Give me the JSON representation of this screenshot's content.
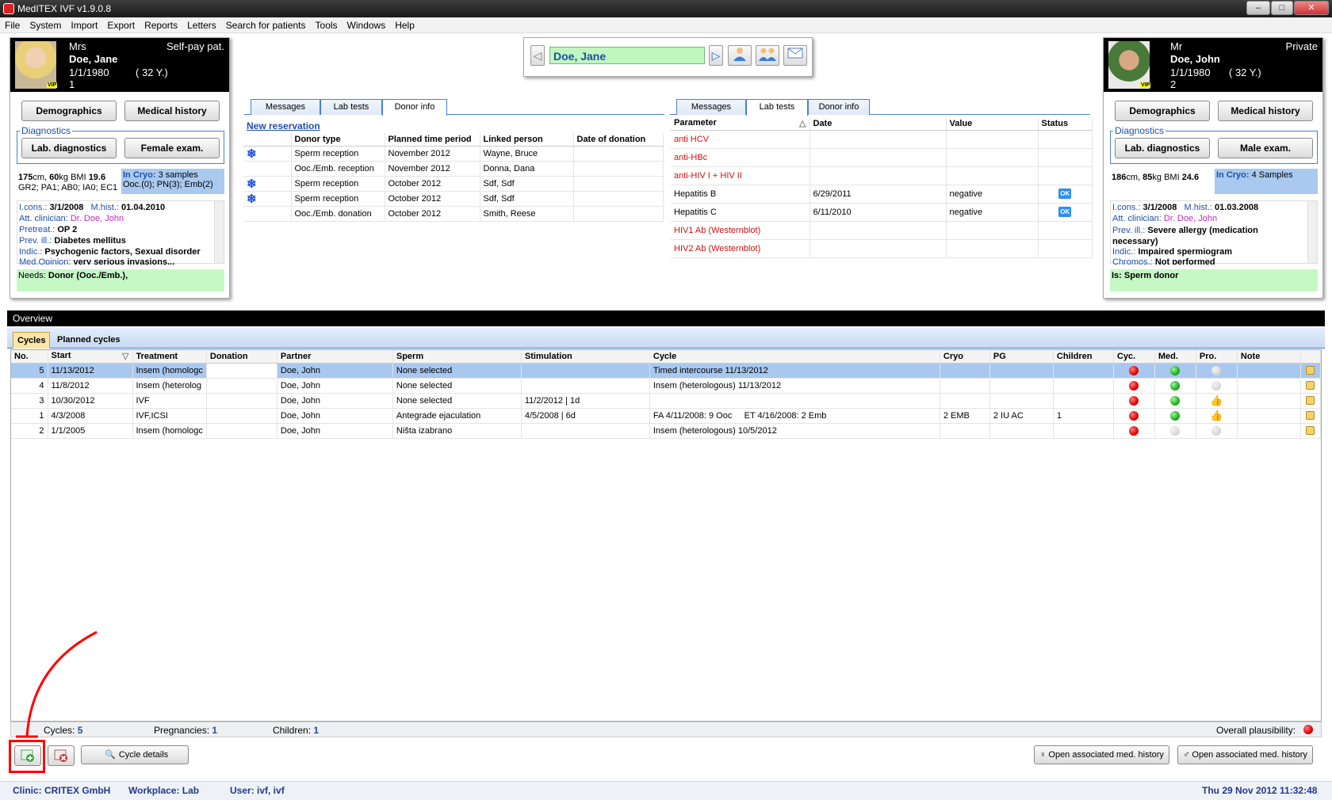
{
  "window": {
    "title": "MedITEX IVF v1.9.0.8",
    "controls": [
      "–",
      "□",
      "✕"
    ]
  },
  "menu": [
    "File",
    "System",
    "Import",
    "Export",
    "Reports",
    "Letters",
    "Search for patients",
    "Tools",
    "Windows",
    "Help"
  ],
  "search": {
    "name": "Doe, Jane",
    "prev_icon": "◁",
    "next_icon": "▷"
  },
  "female": {
    "salutation": "Mrs",
    "type": "Self-pay pat.",
    "name": "Doe, Jane",
    "dob": "1/1/1980",
    "age": "( 32 Y.)",
    "number": "1",
    "vip": "VIP",
    "btn_demographics": "Demographics",
    "btn_medical_history": "Medical history",
    "diagnostics_label": "Diagnostics",
    "btn_lab": "Lab. diagnostics",
    "btn_exam": "Female exam.",
    "height": "175",
    "weight": "60",
    "bmi": "19.6",
    "obstetric": "GR2; PA1; AB0; IA0; EC1",
    "cryo_label": "In Cryo:",
    "cryo_value": "3 samples",
    "cryo_detail": "Ooc.(0); PN(3); Emb(2)",
    "lcons_label": "I.cons.:",
    "lcons": "3/1/2008",
    "mhist_label": "M.hist.:",
    "mhist": "01.04.2010",
    "clinician_label": "Att. clinician:",
    "clinician": "Dr. Doe, John",
    "pretreat_label": "Pretreat.:",
    "pretreat": "OP 2",
    "prev_ill_label": "Prev. ill.:",
    "prev_ill": "Diabetes mellitus",
    "indic_label": "Indic.:",
    "indic": "Psychogenic factors, Sexual disorder",
    "medop_label": "Med.Opinion:",
    "medop": "very serious invasions...",
    "needs_label": "Needs:",
    "needs": "Donor (Ooc./Emb.),"
  },
  "male": {
    "salutation": "Mr",
    "type": "Private",
    "name": "Doe, John",
    "dob": "1/1/1980",
    "age": "( 32 Y.)",
    "number": "2",
    "vip": "VIP",
    "btn_demographics": "Demographics",
    "btn_medical_history": "Medical history",
    "diagnostics_label": "Diagnostics",
    "btn_lab": "Lab. diagnostics",
    "btn_exam": "Male exam.",
    "height": "186",
    "weight": "85",
    "bmi": "24.6",
    "cryo_label": "In Cryo:",
    "cryo_value": "4 Samples",
    "lcons_label": "I.cons.:",
    "lcons": "3/1/2008",
    "mhist_label": "M.hist.:",
    "mhist": "01.03.2008",
    "clinician_label": "Att. clinician:",
    "clinician": "Dr. Doe, John",
    "prev_ill_label": "Prev. ill.:",
    "prev_ill": "Severe allergy (medication necessary)",
    "indic_label": "Indic.:",
    "indic": "Impaired spermiogram",
    "chromos_label": "Chromos.:",
    "chromos": "Not performed",
    "is_label": "Is:",
    "is": "Sperm donor"
  },
  "left_panel": {
    "tabs": [
      "Messages",
      "Lab tests",
      "Donor info"
    ],
    "new_reservation": "New reservation",
    "headers": [
      "Donor type",
      "Planned time period",
      "Linked person",
      "Date of donation"
    ],
    "rows": [
      {
        "flake": true,
        "type": "Sperm reception",
        "period": "November 2012",
        "person": "Wayne, Bruce",
        "date": ""
      },
      {
        "flake": false,
        "type": "Ooc./Emb. reception",
        "period": "November 2012",
        "person": "Donna, Dana",
        "date": ""
      },
      {
        "flake": true,
        "type": "Sperm reception",
        "period": "October 2012",
        "person": "Sdf, Sdf",
        "date": ""
      },
      {
        "flake": true,
        "type": "Sperm reception",
        "period": "October 2012",
        "person": "Sdf, Sdf",
        "date": ""
      },
      {
        "flake": false,
        "type": "Ooc./Emb. donation",
        "period": "October 2012",
        "person": "Smith, Reese",
        "date": ""
      }
    ]
  },
  "right_panel": {
    "tabs": [
      "Messages",
      "Lab tests",
      "Donor info"
    ],
    "headers": [
      "Parameter",
      "Date",
      "Value",
      "Status"
    ],
    "rows": [
      {
        "param": "anti HCV",
        "date": "",
        "value": "",
        "status": "",
        "red": true
      },
      {
        "param": "anti-HBc",
        "date": "",
        "value": "",
        "status": "",
        "red": true
      },
      {
        "param": "anti-HIV I + HIV II",
        "date": "",
        "value": "",
        "status": "",
        "red": true
      },
      {
        "param": "Hepatitis B",
        "date": "6/29/2011",
        "value": "negative",
        "status": "OK",
        "red": false
      },
      {
        "param": "Hepatitis C",
        "date": "6/11/2010",
        "value": "negative",
        "status": "OK",
        "red": false
      },
      {
        "param": "HIV1 Ab (Westernblot)",
        "date": "",
        "value": "",
        "status": "",
        "red": true
      },
      {
        "param": "HIV2 Ab (Westernblot)",
        "date": "",
        "value": "",
        "status": "",
        "red": true
      }
    ]
  },
  "overview": {
    "title": "Overview",
    "tabs": [
      "Cycles",
      "Planned cycles"
    ],
    "headers": [
      "No.",
      "Start",
      "Treatment",
      "Donation",
      "Partner",
      "Sperm",
      "Stimulation",
      "Cycle",
      "Cryo",
      "PG",
      "Children",
      "Cyc.",
      "Med.",
      "Pro.",
      "Note"
    ],
    "rows": [
      {
        "no": "5",
        "start": "11/13/2012",
        "treatment": "Insem (homologc",
        "donation": "",
        "partner": "Doe, John",
        "sperm": "None selected",
        "stim": "",
        "cycle": "Timed intercourse 11/13/2012",
        "cryo": "",
        "pg": "",
        "children": "",
        "cyc": "red",
        "med": "green",
        "pro": "gray",
        "selected": true
      },
      {
        "no": "4",
        "start": "11/8/2012",
        "treatment": "Insem (heterolog",
        "donation": "",
        "partner": "Doe, John",
        "sperm": "None selected",
        "stim": "",
        "cycle": "Insem (heterologous) 11/13/2012",
        "cryo": "",
        "pg": "",
        "children": "",
        "cyc": "red",
        "med": "green",
        "pro": "gray",
        "selected": false
      },
      {
        "no": "3",
        "start": "10/30/2012",
        "treatment": "IVF",
        "donation": "",
        "partner": "Doe, John",
        "sperm": "None selected",
        "stim": "11/2/2012 | 1d",
        "cycle": "",
        "cryo": "",
        "pg": "",
        "children": "",
        "cyc": "red",
        "med": "green",
        "pro": "thumb",
        "selected": false
      },
      {
        "no": "1",
        "start": "4/3/2008",
        "treatment": "IVF,ICSI",
        "donation": "",
        "partner": "Doe, John",
        "sperm": "Antegrade ejaculation",
        "stim": "4/5/2008 | 6d",
        "cycle": "FA 4/11/2008: 9 Ooc     ET 4/16/2008: 2 Emb",
        "cryo": "2 EMB",
        "pg": "2 IU AC",
        "children": "1",
        "cyc": "red",
        "med": "green",
        "pro": "thumb",
        "selected": false
      },
      {
        "no": "2",
        "start": "1/1/2005",
        "treatment": "Insem (homologc",
        "donation": "",
        "partner": "Doe, John",
        "sperm": "Ništa izabrano",
        "stim": "",
        "cycle": "Insem (heterologous) 10/5/2012",
        "cryo": "",
        "pg": "",
        "children": "",
        "cyc": "red",
        "med": "gray",
        "pro": "gray",
        "selected": false
      }
    ],
    "cycles_label": "Cycles:",
    "cycles": "5",
    "pregnancies_label": "Pregnancies:",
    "pregnancies": "1",
    "children_label": "Children:",
    "children": "1",
    "plausibility_label": "Overall plausibility:",
    "btn_cycle_details": "Cycle details",
    "btn_open_female": "Open associated med. history",
    "btn_open_male": "Open associated med. history"
  },
  "status": {
    "clinic": "Clinic: CRITEX GmbH",
    "workplace": "Workplace: Lab",
    "user": "User: ivf, ivf",
    "datetime": "Thu 29 Nov 2012 11:32:48"
  },
  "colors": {
    "accent": "#1f4fa8",
    "green_field": "#bff7bf",
    "highlight": "#ff0000"
  }
}
